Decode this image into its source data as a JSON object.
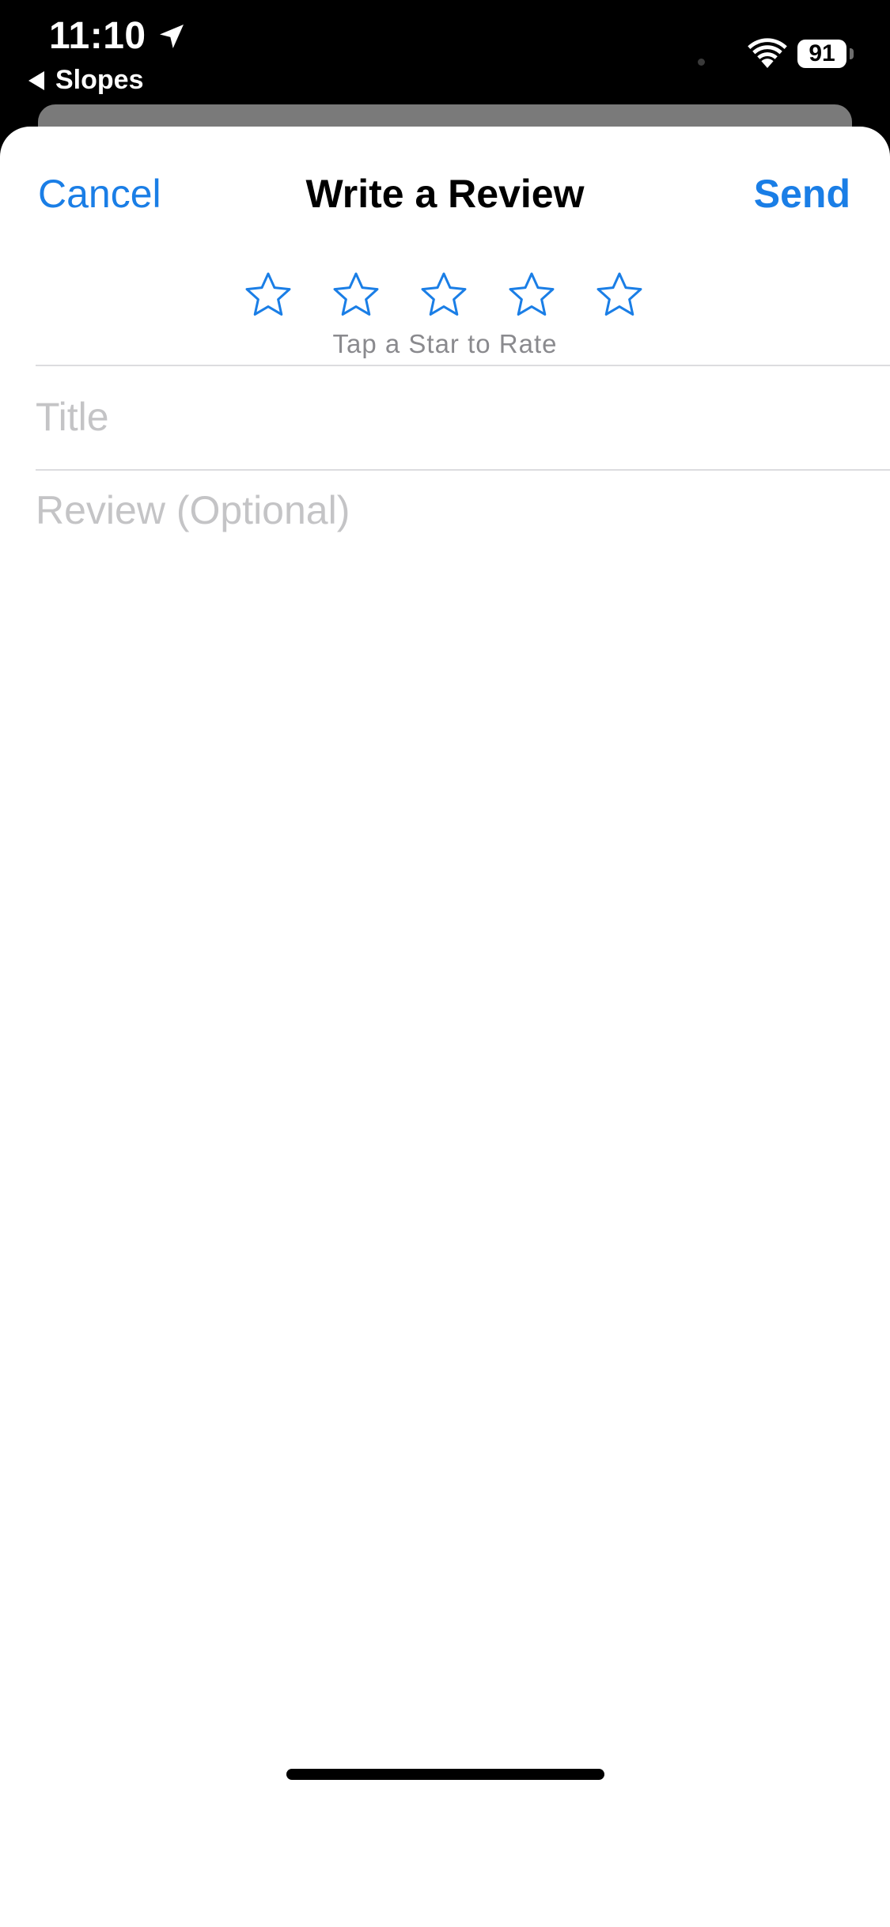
{
  "status_bar": {
    "time": "11:10",
    "back_app_label": "Slopes",
    "battery_level": "91"
  },
  "nav": {
    "cancel_label": "Cancel",
    "title": "Write a Review",
    "send_label": "Send"
  },
  "rating": {
    "max_stars": 5,
    "selected_stars": 0,
    "hint": "Tap a Star to Rate"
  },
  "form": {
    "title_placeholder": "Title",
    "title_value": "",
    "review_placeholder": "Review (Optional)",
    "review_value": ""
  },
  "colors": {
    "accent": "#1a7ee6",
    "placeholder": "#c4c4c6",
    "hint": "#8a8a8e",
    "divider": "#dcdcdf"
  }
}
